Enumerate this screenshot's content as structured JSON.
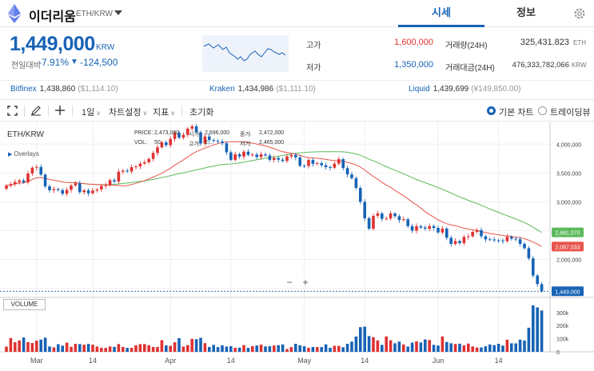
{
  "header": {
    "title": "이더리움",
    "pair": "ETH/KRW",
    "tabs": [
      "시세",
      "정보"
    ]
  },
  "summary": {
    "price": "1,449,000",
    "unit": "KRW",
    "change_label": "전일대비",
    "change_pct": "-7.91%",
    "change_arrow": "▼",
    "change_abs": "-124,500"
  },
  "stats": [
    {
      "label": "고가",
      "value": "1,600,000",
      "color": "#e03131"
    },
    {
      "label": "저가",
      "value": "1,350,000",
      "color": "#1763b6"
    },
    {
      "label": "거래량(24H)",
      "value": "325,431.823",
      "unit": "ETH"
    },
    {
      "label": "거래대금(24H)",
      "value": "476,333,782,066",
      "unit": "KRW"
    }
  ],
  "exchanges": [
    {
      "name": "Bitfinex",
      "price": "1,438,860",
      "sub": "($1,114.10)"
    },
    {
      "name": "Kraken",
      "price": "1,434,986",
      "sub": "($1,111.10)"
    },
    {
      "name": "Liquid",
      "price": "1,439,699",
      "sub": "(¥149,850.00)"
    }
  ],
  "toolbar": {
    "interval": "1일",
    "chart_settings": "차트설정",
    "indicators": "지표",
    "reset": "초기화",
    "basic_chart": "기본 차트",
    "tradingview": "트레이딩뷰"
  },
  "chart": {
    "symbol": "ETH/KRW",
    "overlays": "Overlays",
    "volume_label": "VOLUME",
    "price_tag": "1,449,000",
    "ma_short_tag": "2,087,033",
    "ma_long_tag": "2,681,070",
    "ohlc": [
      {
        "k": "PRICE:",
        "v": "2,473,000"
      },
      {
        "k": "시가:",
        "v": "2,696,000"
      },
      {
        "k": "종가:",
        "v": "2,472,000"
      },
      {
        "k": "VOL:",
        "v": "50,"
      },
      {
        "k": "고가:",
        "v": "2,..."
      },
      {
        "k": "저가:",
        "v": "2,465,000"
      }
    ],
    "zoom_minus": "−",
    "zoom_plus": "+"
  },
  "colors": {
    "up": "#e03131",
    "down": "#1763b6",
    "ma_short": "#e8554d",
    "ma_long": "#5cba5c",
    "accent": "#1763b6"
  },
  "chart_data": {
    "type": "candlestick",
    "x_ticks": [
      "Mar",
      "14",
      "Apr",
      "14",
      "May",
      "14",
      "Jun",
      "14"
    ],
    "y_ticks": [
      "4,000,000",
      "3,500,000",
      "3,000,000",
      "2,500,000",
      "2,000,000",
      "1,500,000"
    ],
    "vol_ticks": [
      "300k",
      "200k",
      "100k",
      "0"
    ],
    "ylim": [
      1370000,
      4350000
    ],
    "vol_max": 360000,
    "candles": [
      [
        3226000,
        3281000
      ],
      [
        3281000,
        3307000
      ],
      [
        3307000,
        3343000
      ],
      [
        3343000,
        3371000
      ],
      [
        3371000,
        3337000
      ],
      [
        3337000,
        3491000
      ],
      [
        3491000,
        3591000
      ],
      [
        3591000,
        3604000
      ],
      [
        3604000,
        3472000
      ],
      [
        3472000,
        3268000
      ],
      [
        3268000,
        3200000
      ],
      [
        3200000,
        3220000
      ],
      [
        3220000,
        3203000
      ],
      [
        3203000,
        3140000
      ],
      [
        3140000,
        3207000
      ],
      [
        3207000,
        3284000
      ],
      [
        3284000,
        3322000
      ],
      [
        3322000,
        3167000
      ],
      [
        3167000,
        3198000
      ],
      [
        3198000,
        3147000
      ],
      [
        3147000,
        3196000
      ],
      [
        3196000,
        3215000
      ],
      [
        3215000,
        3274000
      ],
      [
        3274000,
        3289000
      ],
      [
        3289000,
        3376000
      ],
      [
        3376000,
        3352000
      ],
      [
        3352000,
        3521000
      ],
      [
        3521000,
        3541000
      ],
      [
        3541000,
        3525000
      ],
      [
        3525000,
        3601000
      ],
      [
        3601000,
        3614000
      ],
      [
        3614000,
        3662000
      ],
      [
        3662000,
        3686000
      ],
      [
        3686000,
        3744000
      ],
      [
        3744000,
        3847000
      ],
      [
        3847000,
        3945000
      ],
      [
        3945000,
        4031000
      ],
      [
        4031000,
        3981000
      ],
      [
        3981000,
        4090000
      ],
      [
        4090000,
        4197000
      ],
      [
        4197000,
        4111000
      ],
      [
        4111000,
        4161000
      ],
      [
        4161000,
        4269000
      ],
      [
        4269000,
        4308000
      ],
      [
        4308000,
        4207000
      ],
      [
        4207000,
        4010000
      ],
      [
        4010000,
        4133000
      ],
      [
        4133000,
        4070000
      ],
      [
        4070000,
        4055000
      ],
      [
        4055000,
        4044000
      ],
      [
        4044000,
        4016000
      ],
      [
        4016000,
        3858000
      ],
      [
        3858000,
        3727000
      ],
      [
        3727000,
        3825000
      ],
      [
        3825000,
        3784000
      ],
      [
        3784000,
        3868000
      ],
      [
        3868000,
        3815000
      ],
      [
        3815000,
        3819000
      ],
      [
        3819000,
        3776000
      ],
      [
        3776000,
        3824000
      ],
      [
        3824000,
        3804000
      ],
      [
        3804000,
        3726000
      ],
      [
        3726000,
        3760000
      ],
      [
        3760000,
        3731000
      ],
      [
        3731000,
        3708000
      ],
      [
        3708000,
        3787000
      ],
      [
        3787000,
        3812000
      ],
      [
        3812000,
        3769000
      ],
      [
        3769000,
        3624000
      ],
      [
        3624000,
        3621000
      ],
      [
        3621000,
        3725000
      ],
      [
        3725000,
        3659000
      ],
      [
        3659000,
        3670000
      ],
      [
        3670000,
        3634000
      ],
      [
        3634000,
        3601000
      ],
      [
        3601000,
        3591000
      ],
      [
        3591000,
        3661000
      ],
      [
        3661000,
        3739000
      ],
      [
        3739000,
        3585000
      ],
      [
        3585000,
        3475000
      ],
      [
        3475000,
        3410000
      ],
      [
        3410000,
        3240000
      ],
      [
        3240000,
        2999000
      ],
      [
        2999000,
        2715000
      ],
      [
        2715000,
        2533000
      ],
      [
        2533000,
        2757000
      ],
      [
        2757000,
        2799000
      ],
      [
        2799000,
        2705000
      ],
      [
        2705000,
        2710000
      ],
      [
        2710000,
        2798000
      ],
      [
        2798000,
        2751000
      ],
      [
        2751000,
        2683000
      ],
      [
        2683000,
        2697000
      ],
      [
        2697000,
        2578000
      ],
      [
        2578000,
        2501000
      ],
      [
        2501000,
        2578000
      ],
      [
        2578000,
        2554000
      ],
      [
        2554000,
        2534000
      ],
      [
        2534000,
        2579000
      ],
      [
        2579000,
        2548000
      ],
      [
        2548000,
        2468000
      ],
      [
        2468000,
        2536000
      ],
      [
        2536000,
        2377000
      ],
      [
        2377000,
        2270000
      ],
      [
        2270000,
        2320000
      ],
      [
        2320000,
        2284000
      ],
      [
        2284000,
        2392000
      ],
      [
        2392000,
        2402000
      ],
      [
        2402000,
        2479000
      ],
      [
        2479000,
        2510000
      ],
      [
        2510000,
        2403000
      ],
      [
        2403000,
        2350000
      ],
      [
        2350000,
        2347000
      ],
      [
        2347000,
        2332000
      ],
      [
        2332000,
        2330000
      ],
      [
        2330000,
        2317000
      ],
      [
        2317000,
        2393000
      ],
      [
        2393000,
        2360000
      ],
      [
        2360000,
        2351000
      ],
      [
        2351000,
        2272000
      ],
      [
        2272000,
        2196000
      ],
      [
        2196000,
        2020000
      ],
      [
        2020000,
        1722000
      ],
      [
        1722000,
        1573000
      ],
      [
        1573000,
        1449000
      ]
    ],
    "volume": [
      40000,
      105000,
      73000,
      87000,
      109000,
      74000,
      67000,
      85000,
      93000,
      108000,
      41000,
      34000,
      58000,
      47000,
      70000,
      38000,
      61000,
      59000,
      54000,
      60000,
      54000,
      40000,
      30000,
      30000,
      41000,
      38000,
      59000,
      37000,
      30000,
      30000,
      50000,
      59000,
      59000,
      50000,
      37000,
      37000,
      89000,
      50000,
      46000,
      73000,
      104000,
      40000,
      51000,
      99000,
      96000,
      107000,
      66000,
      37000,
      53000,
      36000,
      49000,
      40000,
      43000,
      31000,
      32000,
      51000,
      30000,
      43000,
      48000,
      55000,
      41000,
      43000,
      48000,
      51000,
      56000,
      21000,
      36000,
      61000,
      49000,
      43000,
      30000,
      37000,
      36000,
      36000,
      57000,
      31000,
      46000,
      45000,
      35000,
      61000,
      78000,
      117000,
      188000,
      192000,
      120000,
      112000,
      87000,
      53000,
      117000,
      88000,
      65000,
      78000,
      56000,
      40000,
      70000,
      80000,
      71000,
      94000,
      90000,
      53000,
      48000,
      117000,
      75000,
      65000,
      60000,
      62000,
      49000,
      63000,
      41000,
      33000,
      33000,
      42000,
      56000,
      51000,
      61000,
      47000,
      92000,
      65000,
      64000,
      93000,
      86000,
      184000,
      354000,
      339000,
      315000,
      288000
    ]
  }
}
